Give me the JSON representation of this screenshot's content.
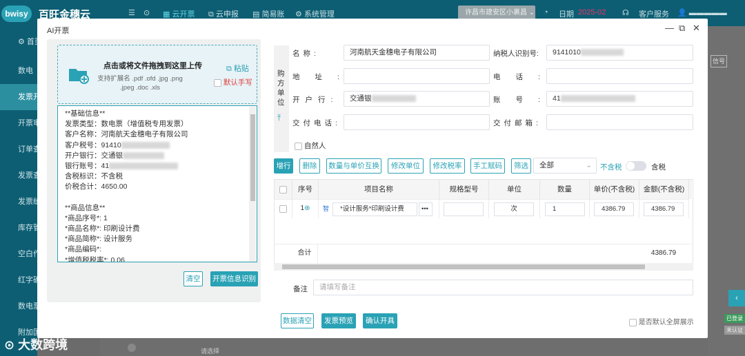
{
  "topbar": {
    "logo": "bwisy",
    "brand": "百旺金穗云",
    "nav": [
      "云开票",
      "云申报",
      "简易账",
      "系统管理"
    ],
    "location": "许昌市建安区小裹昌",
    "date_label": "日期",
    "date_value": "2025-02",
    "service": "客户服务"
  },
  "sidebar": [
    "首页",
    "数电",
    "发票开",
    "开票审",
    "订单查",
    "发票查",
    "发票统",
    "库存管",
    "空白作",
    "红字确",
    "数电票",
    "附加国"
  ],
  "background": {
    "right_btn": "信号",
    "right_badge1": "已登录",
    "right_badge2": "未认证",
    "bottom_select": "请选择"
  },
  "modal": {
    "title": "AI开票",
    "upload": {
      "main": "点击或将文件拖拽到这里上传",
      "sub": "支持扩展名 .pdf .ofd .jpg .png .jpeg .doc .xls",
      "paste": "粘贴",
      "default_handwrite": "默认手写"
    },
    "textarea_lines": [
      "**基础信息**",
      "发票类型：数电票（增值税专用发票）",
      "客户名称：河南航天金穗电子有限公司",
      "客户税号：91410",
      "开户银行：交通银",
      "银行账号：41",
      "含税标识：不含税",
      "价税合计：4650.00",
      "",
      "**商品信息**",
      "*商品序号*: 1",
      "*商品名称*: 印刷设计费",
      "*商品简称*: 设计服务",
      "*商品编码*:",
      "*增值税税率*: 0.06"
    ],
    "clear_btn": "清空",
    "recognize_btn": "开票信息识别",
    "buyer": {
      "side_label": "购方单位",
      "name_label": "名称:",
      "name_value": "河南航天金穗电子有限公司",
      "tax_label": "纳税人识别号:",
      "tax_value": "9141010",
      "addr_label": "地址:",
      "addr_value": "",
      "phone_label": "电话:",
      "phone_value": "",
      "bank_label": "开户行:",
      "bank_value": "交通银",
      "account_label": "账号:",
      "account_value": "41",
      "mobile_label": "交付电话:",
      "mobile_value": "",
      "email_label": "交付邮箱:",
      "email_value": "",
      "natural_person": "自然人"
    },
    "toolbar": {
      "add": "增行",
      "delete": "删除",
      "swap": "数量与单价互换",
      "unit": "修改单位",
      "rate": "修改税率",
      "code": "手工赋码",
      "filter": "筛选",
      "filter_select": "全部",
      "tax_excl": "不含税",
      "tax_incl": "含税"
    },
    "table": {
      "headers": [
        "序号",
        "项目名称",
        "规格型号",
        "单位",
        "数量",
        "单价(不含税)",
        "金额(不含税)"
      ],
      "row": {
        "index": "1",
        "tag": "智",
        "name": "*设计服务*印刷设计费",
        "spec": "",
        "unit": "次",
        "qty": "1",
        "price": "4386.79",
        "amount": "4386.79"
      },
      "sum_label": "合计",
      "sum_amount": "4386.79"
    },
    "remark_label": "备注",
    "remark_placeholder": "请填写备注",
    "footer": {
      "clear": "数据清空",
      "preview": "发票预览",
      "confirm": "确认开具",
      "fullscreen": "是否默认全屏展示"
    }
  },
  "watermark": "大数跨境",
  "colors": {
    "accent": "#2aa2b5",
    "topbar": "#0d5e73",
    "warn": "#e03b3b"
  }
}
